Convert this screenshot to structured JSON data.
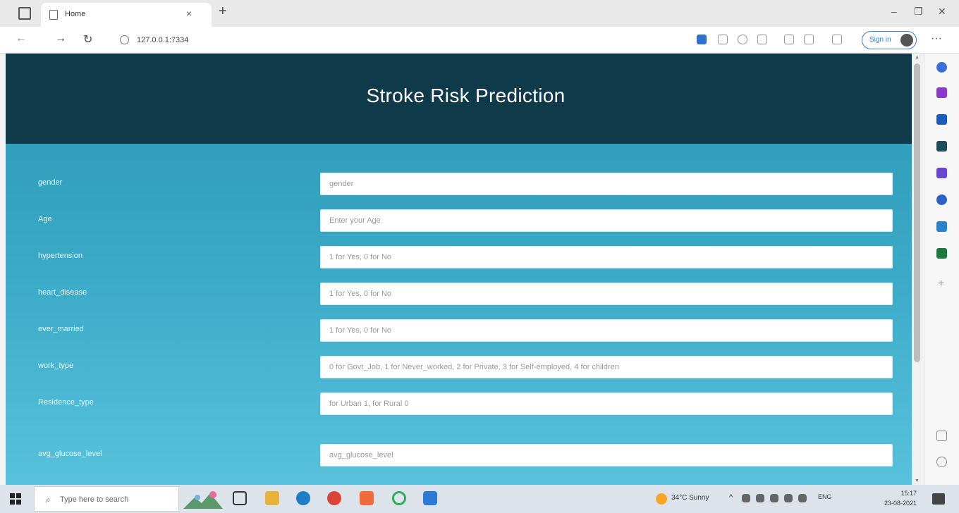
{
  "browser": {
    "tab_title": "Home",
    "tab_close": "×",
    "new_tab": "+",
    "url": "127.0.0.1:7334",
    "signin_label": "Sign in",
    "window_controls": {
      "minimize": "–",
      "restore": "❐",
      "close": "✕"
    },
    "nav": {
      "back": "←",
      "forward": "→",
      "refresh": "↻"
    },
    "more": "···"
  },
  "page": {
    "title": "Stroke Risk Prediction",
    "fields": [
      {
        "label": "gender",
        "placeholder": "gender"
      },
      {
        "label": "Age",
        "placeholder": "Enter your Age"
      },
      {
        "label": "hypertension",
        "placeholder": "1 for Yes, 0 for No"
      },
      {
        "label": "heart_disease",
        "placeholder": "1 for Yes, 0 for No"
      },
      {
        "label": "ever_married",
        "placeholder": "1 for Yes, 0 for No"
      },
      {
        "label": "work_type",
        "placeholder": "0 for Govt_Job, 1 for Never_worked, 2 for Private, 3 for Self-employed, 4 for children"
      },
      {
        "label": "Residence_type",
        "placeholder": "for Urban 1, for Rural 0"
      },
      {
        "label": "avg_glucose_level",
        "placeholder": "avg_glucose_level"
      }
    ]
  },
  "taskbar": {
    "search_placeholder": "Type here to search",
    "weather": "34°C Sunny",
    "tray_caret": "^",
    "language": "ENG",
    "time": "15:17",
    "date": "23-08-2021"
  },
  "colors": {
    "header_bg": "#0e3a4a",
    "page_bg_top": "#2b98b4",
    "page_bg_bottom": "#58c2dc",
    "accent": "#3b7dd8"
  }
}
